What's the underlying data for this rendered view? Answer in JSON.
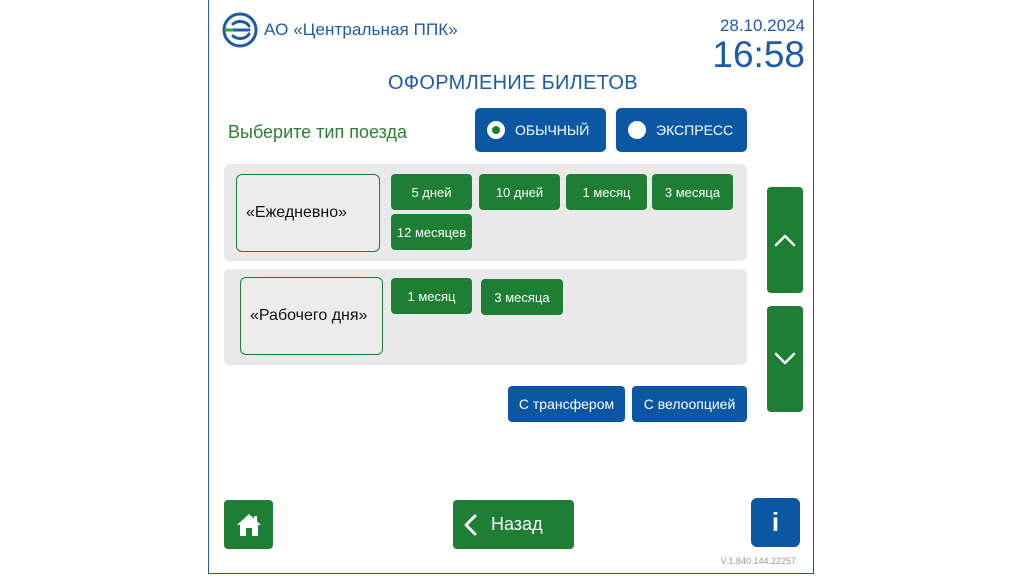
{
  "header": {
    "company": "АО «Центральная ППК»",
    "date": "28.10.2024",
    "time": "16:58"
  },
  "page_title": "ОФОРМЛЕНИЕ БИЛЕТОВ",
  "train_type": {
    "prompt": "Выберите тип поезда",
    "options": [
      {
        "label": "ОБЫЧНЫЙ",
        "selected": true
      },
      {
        "label": "ЭКСПРЕСС",
        "selected": false
      }
    ]
  },
  "categories": [
    {
      "name": "«Ежедневно»",
      "durations": [
        "5 дней",
        "10 дней",
        "1 месяц",
        "3 месяца",
        "12 месяцев"
      ]
    },
    {
      "name": "«Рабочего дня»",
      "durations": [
        "1 месяц",
        "3 месяца"
      ]
    }
  ],
  "extras": [
    "С трансфером",
    "С велоопцией"
  ],
  "footer": {
    "back_label": "Назад",
    "info_label": "i",
    "version": "V.1.840.144.22257"
  },
  "icons": [
    "logo-icon",
    "chevron-up-icon",
    "chevron-down-icon",
    "home-icon",
    "chevron-left-icon"
  ],
  "colors": {
    "primary_blue": "#0b57a4",
    "primary_green": "#1e7e34",
    "text_blue": "#1f5aa8"
  }
}
